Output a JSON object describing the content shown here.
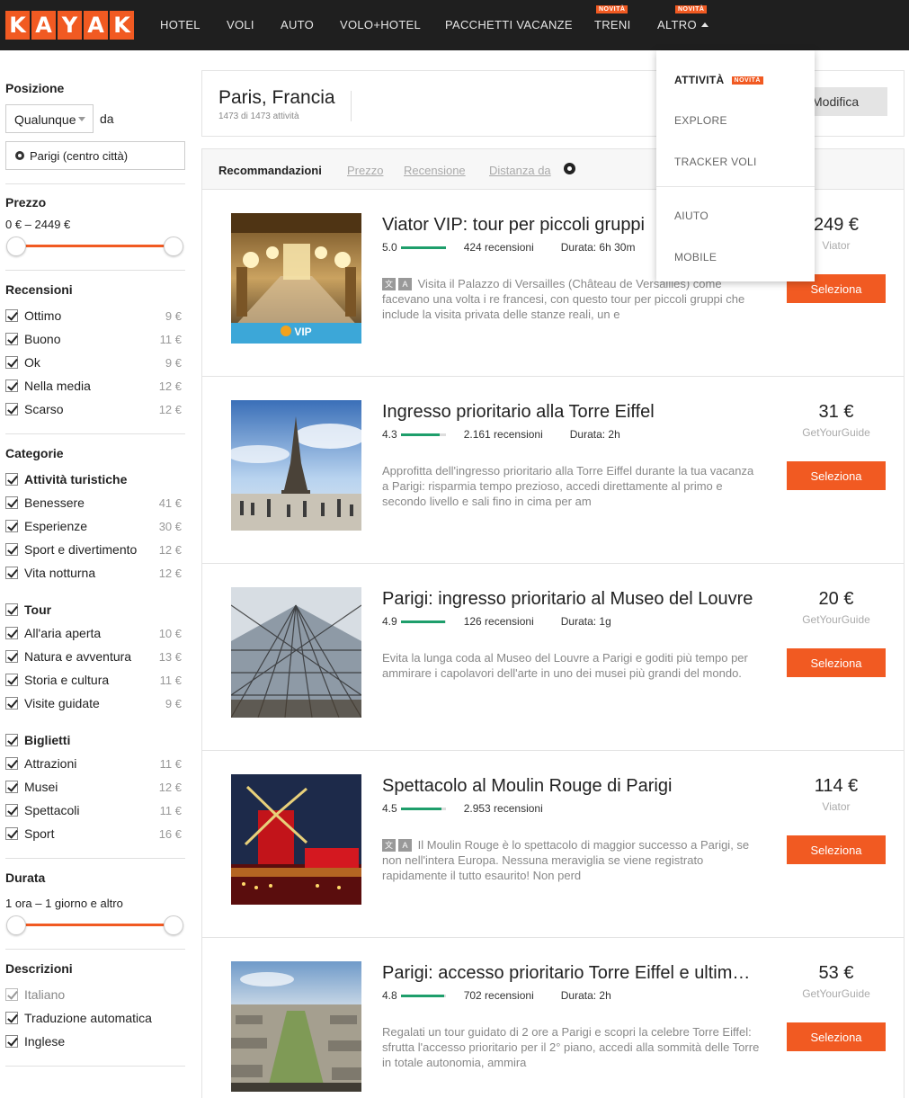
{
  "nav": {
    "logo": [
      "K",
      "A",
      "Y",
      "A",
      "K"
    ],
    "items": [
      {
        "label": "HOTEL",
        "badge": ""
      },
      {
        "label": "VOLI",
        "badge": ""
      },
      {
        "label": "AUTO",
        "badge": ""
      },
      {
        "label": "VOLO+HOTEL",
        "badge": ""
      },
      {
        "label": "PACCHETTI VACANZE",
        "badge": ""
      },
      {
        "label": "TRENI",
        "badge": "NOVITÀ"
      },
      {
        "label": "ALTRO",
        "badge": "NOVITÀ"
      }
    ]
  },
  "dropdown": {
    "items": [
      {
        "label": "ATTIVITÀ",
        "badge": "NOVITÀ"
      },
      {
        "label": "EXPLORE"
      },
      {
        "label": "TRACKER VOLI"
      },
      {
        "label": "AIUTO"
      },
      {
        "label": "MOBILE"
      }
    ]
  },
  "filters": {
    "position": {
      "title": "Posizione",
      "select": "Qualunque",
      "from_label": "da",
      "location": "Parigi (centro città)"
    },
    "price": {
      "title": "Prezzo",
      "range": "0 € – 2449 €"
    },
    "reviews": {
      "title": "Recensioni",
      "items": [
        {
          "label": "Ottimo",
          "price": "9 €"
        },
        {
          "label": "Buono",
          "price": "11 €"
        },
        {
          "label": "Ok",
          "price": "9 €"
        },
        {
          "label": "Nella media",
          "price": "12 €"
        },
        {
          "label": "Scarso",
          "price": "12 €"
        }
      ]
    },
    "categories": {
      "title": "Categorie",
      "groups": [
        {
          "label": "Attività turistiche",
          "items": [
            {
              "label": "Benessere",
              "price": "41 €"
            },
            {
              "label": "Esperienze",
              "price": "30 €"
            },
            {
              "label": "Sport e divertimento",
              "price": "12 €"
            },
            {
              "label": "Vita notturna",
              "price": "12 €"
            }
          ]
        },
        {
          "label": "Tour",
          "items": [
            {
              "label": "All'aria aperta",
              "price": "10 €"
            },
            {
              "label": "Natura e avventura",
              "price": "13 €"
            },
            {
              "label": "Storia e cultura",
              "price": "11 €"
            },
            {
              "label": "Visite guidate",
              "price": "9 €"
            }
          ]
        },
        {
          "label": "Biglietti",
          "items": [
            {
              "label": "Attrazioni",
              "price": "11 €"
            },
            {
              "label": "Musei",
              "price": "12 €"
            },
            {
              "label": "Spettacoli",
              "price": "11 €"
            },
            {
              "label": "Sport",
              "price": "16 €"
            }
          ]
        }
      ]
    },
    "duration": {
      "title": "Durata",
      "range": "1 ora – 1 giorno e altro"
    },
    "descriptions": {
      "title": "Descrizioni",
      "items": [
        {
          "label": "Italiano"
        },
        {
          "label": "Traduzione automatica"
        },
        {
          "label": "Inglese"
        }
      ]
    }
  },
  "header": {
    "city": "Paris, Francia",
    "count": "1473 di 1473 attività",
    "modify": "Modifica"
  },
  "sort": {
    "options": [
      "Recommandazioni",
      "Prezzo",
      "Recensione",
      "Distanza da"
    ]
  },
  "results": [
    {
      "title": "Viator VIP: tour per piccoli gruppi",
      "rating": "5.0",
      "rating_fraction": 1.0,
      "reviews": "424 recensioni",
      "duration": "Durata: 6h 30m",
      "translated": true,
      "desc": "Visita il Palazzo di Versailles (Château de Versailles) come facevano una volta i re francesi, con questo tour per piccoli gruppi che include la visita privata delle stanze reali, un e",
      "price": "249 €",
      "provider": "Viator",
      "cta": "Seleziona",
      "badge": "VIP",
      "image": "versailles"
    },
    {
      "title": "Ingresso prioritario alla Torre Eiffel",
      "rating": "4.3",
      "rating_fraction": 0.86,
      "reviews": "2.161 recensioni",
      "duration": "Durata: 2h",
      "translated": false,
      "desc": "Approfitta dell'ingresso prioritario alla Torre Eiffel durante la tua vacanza a Parigi: risparmia tempo prezioso, accedi direttamente al primo e secondo livello e sali fino in cima per am",
      "price": "31 €",
      "provider": "GetYourGuide",
      "cta": "Seleziona",
      "image": "eiffel"
    },
    {
      "title": "Parigi: ingresso prioritario al Museo del Louvre",
      "rating": "4.9",
      "rating_fraction": 0.98,
      "reviews": "126 recensioni",
      "duration": "Durata: 1g",
      "translated": false,
      "desc": "Evita la lunga coda al Museo del Louvre a Parigi e goditi più tempo per ammirare i capolavori dell'arte in uno dei musei più grandi del mondo.",
      "price": "20 €",
      "provider": "GetYourGuide",
      "cta": "Seleziona",
      "image": "louvre"
    },
    {
      "title": "Spettacolo al Moulin Rouge di Parigi",
      "rating": "4.5",
      "rating_fraction": 0.9,
      "reviews": "2.953 recensioni",
      "duration": "",
      "translated": true,
      "desc": "Il Moulin Rouge è lo spettacolo di maggior successo a Parigi, se non nell'intera Europa. Nessuna meraviglia se viene registrato rapidamente il tutto esaurito! Non perd",
      "price": "114 €",
      "provider": "Viator",
      "cta": "Seleziona",
      "image": "moulin"
    },
    {
      "title": "Parigi: accesso prioritario Torre Eiffel e ultimo piano",
      "rating": "4.8",
      "rating_fraction": 0.96,
      "reviews": "702 recensioni",
      "duration": "Durata: 2h",
      "translated": false,
      "desc": "Regalati un tour guidato di 2 ore a Parigi e scopri la celebre Torre Eiffel: sfrutta l'accesso prioritario per il 2° piano, accedi alla sommità delle Torre in totale autonomia, ammira",
      "price": "53 €",
      "provider": "GetYourGuide",
      "cta": "Seleziona",
      "image": "aerial"
    }
  ],
  "colors": {
    "accent": "#f15a22",
    "rating": "#1e9e6b",
    "nav_bg": "#1f1f1f"
  }
}
